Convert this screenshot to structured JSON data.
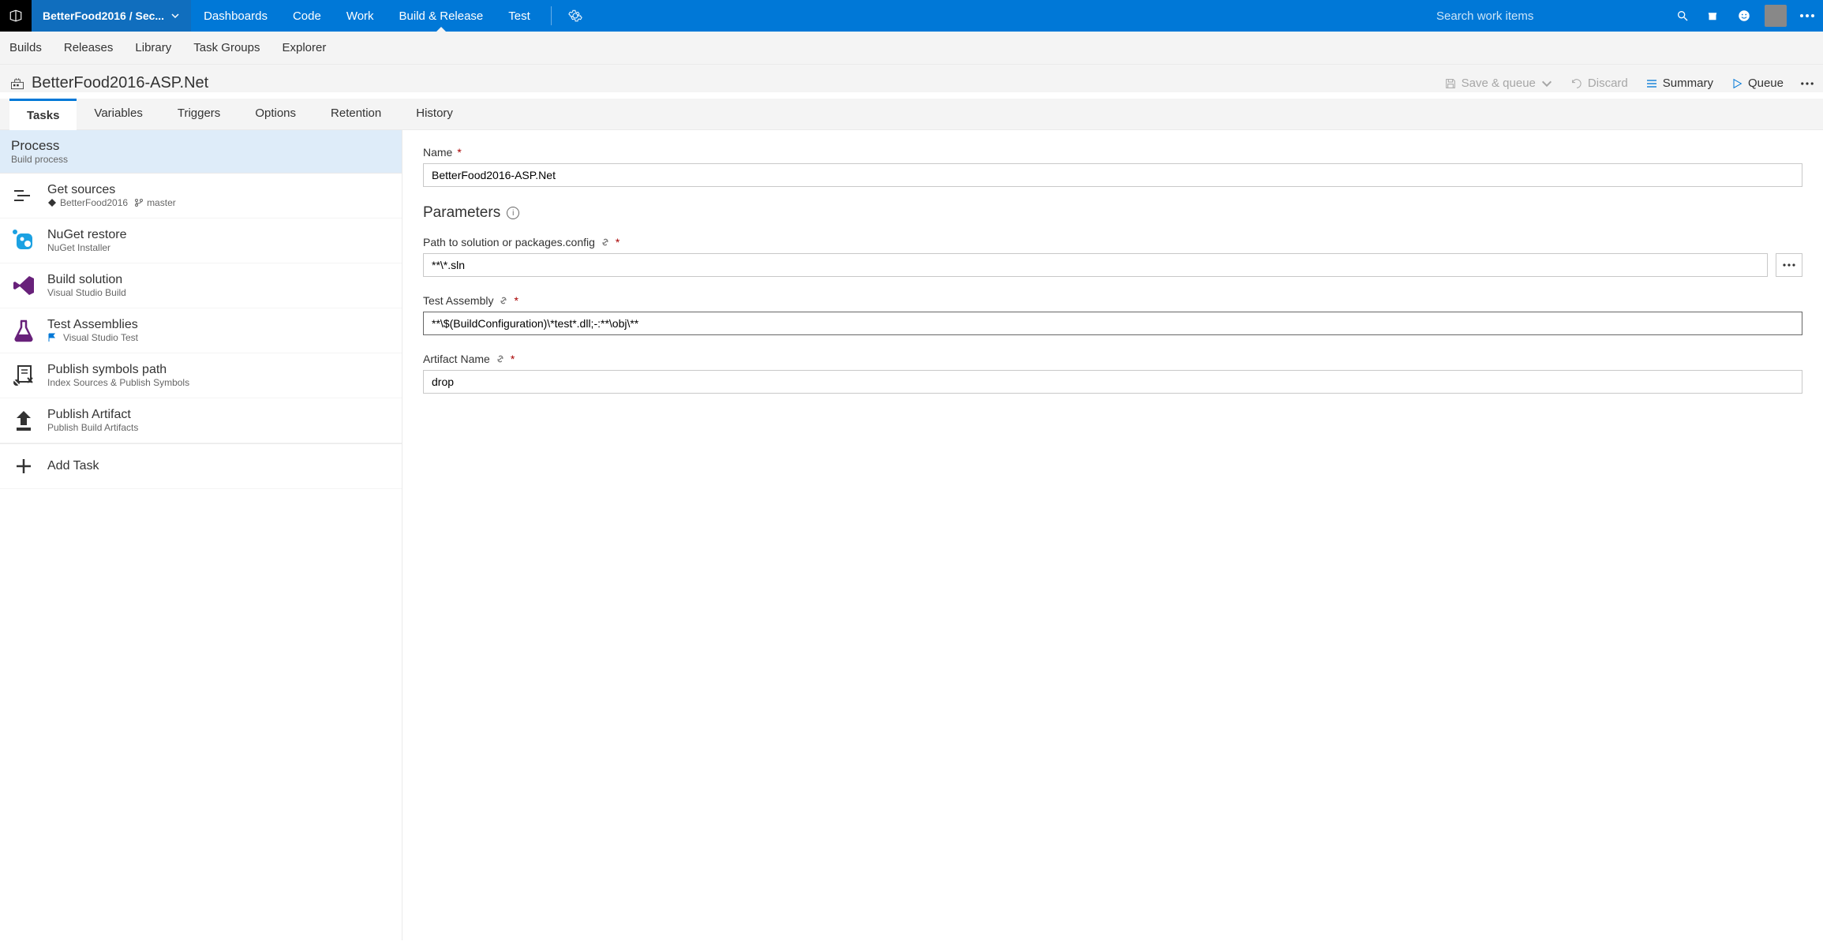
{
  "topnav": {
    "project": "BetterFood2016 / Sec...",
    "tabs": [
      "Dashboards",
      "Code",
      "Work",
      "Build & Release",
      "Test"
    ],
    "active_tab": 3,
    "search_placeholder": "Search work items"
  },
  "subnav": [
    "Builds",
    "Releases",
    "Library",
    "Task Groups",
    "Explorer"
  ],
  "title": "BetterFood2016-ASP.Net",
  "title_actions": {
    "save_queue": "Save & queue",
    "discard": "Discard",
    "summary": "Summary",
    "queue": "Queue"
  },
  "detail_tabs": [
    "Tasks",
    "Variables",
    "Triggers",
    "Options",
    "Retention",
    "History"
  ],
  "active_detail_tab": 0,
  "process": {
    "title": "Process",
    "subtitle": "Build process"
  },
  "tasks": [
    {
      "title": "Get sources",
      "repo": "BetterFood2016",
      "branch": "master"
    },
    {
      "title": "NuGet restore",
      "sub": "NuGet Installer"
    },
    {
      "title": "Build solution",
      "sub": "Visual Studio Build"
    },
    {
      "title": "Test Assemblies",
      "sub": "Visual Studio Test",
      "flag": true
    },
    {
      "title": "Publish symbols path",
      "sub": "Index Sources & Publish Symbols"
    },
    {
      "title": "Publish Artifact",
      "sub": "Publish Build Artifacts"
    }
  ],
  "add_task_label": "Add Task",
  "form": {
    "name_label": "Name",
    "name_value": "BetterFood2016-ASP.Net",
    "parameters_heading": "Parameters",
    "solution_label": "Path to solution or packages.config",
    "solution_value": "**\\*.sln",
    "test_label": "Test Assembly",
    "test_value": "**\\$(BuildConfiguration)\\*test*.dll;-:**\\obj\\**",
    "artifact_label": "Artifact Name",
    "artifact_value": "drop"
  }
}
